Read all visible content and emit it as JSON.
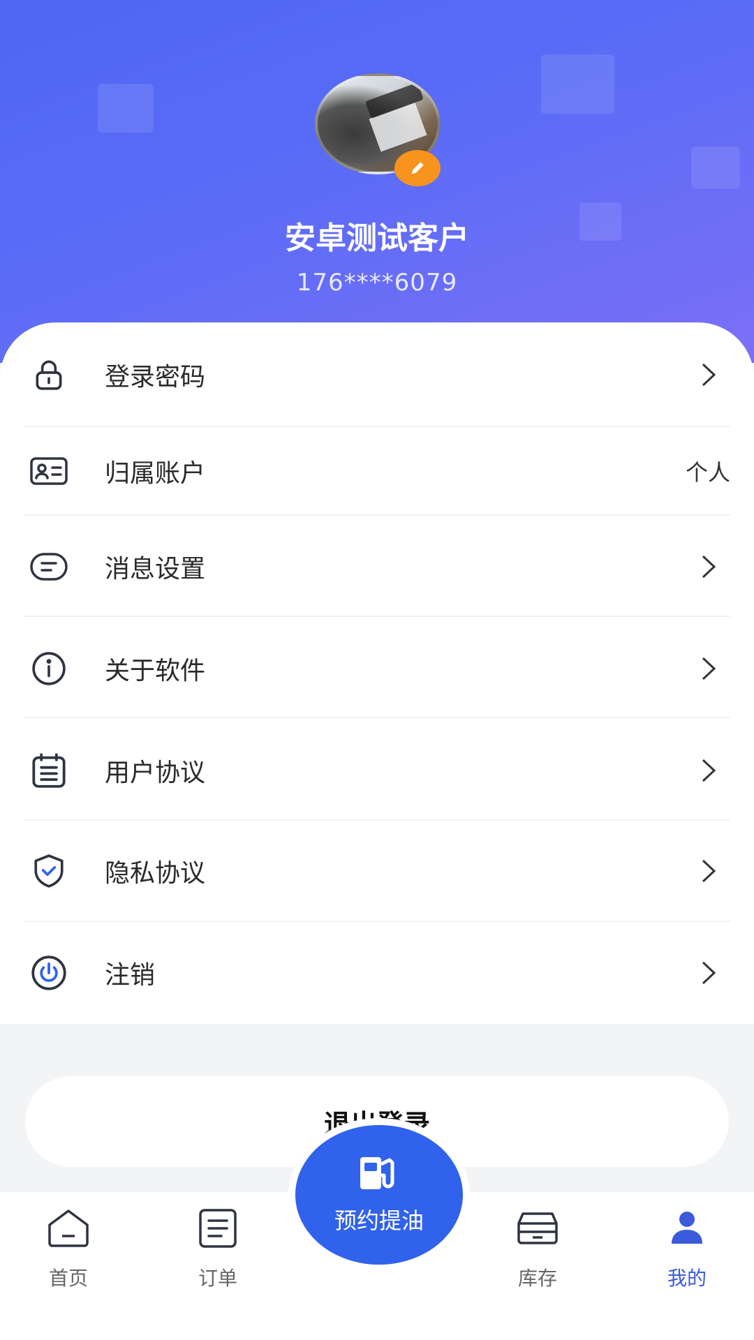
{
  "profile": {
    "name": "安卓测试客户",
    "phone": "176****6079"
  },
  "menu": {
    "items": [
      {
        "label": "登录密码",
        "icon": "lock-icon"
      },
      {
        "label": "归属账户",
        "icon": "id-card-icon",
        "value": "个人"
      },
      {
        "label": "消息设置",
        "icon": "message-icon"
      },
      {
        "label": "关于软件",
        "icon": "info-icon"
      },
      {
        "label": "用户协议",
        "icon": "document-icon"
      },
      {
        "label": "隐私协议",
        "icon": "shield-check-icon"
      },
      {
        "label": "注销",
        "icon": "power-icon"
      }
    ]
  },
  "logout": {
    "label": "退出登录"
  },
  "nav": {
    "items": [
      {
        "label": "首页",
        "icon": "home-icon"
      },
      {
        "label": "订单",
        "icon": "order-icon"
      },
      {
        "label": "库存",
        "icon": "inventory-icon"
      },
      {
        "label": "我的",
        "icon": "user-icon"
      }
    ],
    "center": {
      "label": "预约提油",
      "icon": "fuel-pump-icon"
    }
  },
  "colors": {
    "header_start": "#4f66f3",
    "header_end": "#7d6ff7",
    "accent": "#3162ec",
    "badge": "#f7941d",
    "active_nav": "#3b5bdb"
  }
}
